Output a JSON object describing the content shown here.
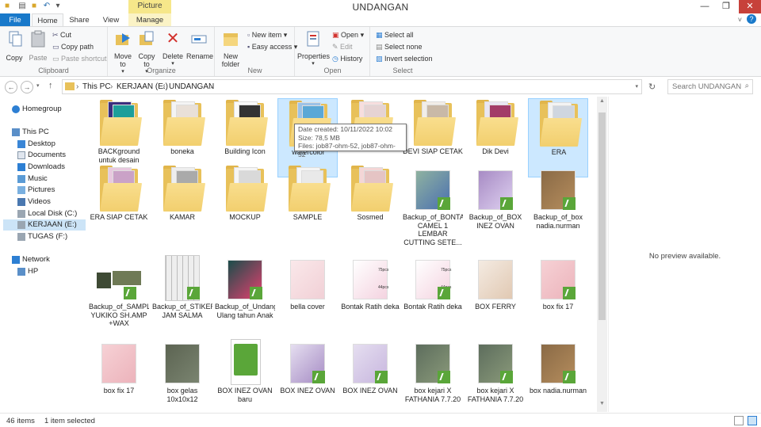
{
  "window": {
    "title": "UNDANGAN",
    "contextual_tab_group": "Picture Tools",
    "controls": {
      "minimize": "—",
      "restore": "❐",
      "close": "✕"
    }
  },
  "tabs": [
    {
      "label": "File"
    },
    {
      "label": "Home"
    },
    {
      "label": "Share"
    },
    {
      "label": "View"
    },
    {
      "label": "Manage"
    }
  ],
  "ribbon": {
    "clipboard": {
      "label": "Clipboard",
      "copy": "Copy",
      "paste": "Paste",
      "cut": "Cut",
      "copy_path": "Copy path",
      "paste_shortcut": "Paste shortcut"
    },
    "organize": {
      "label": "Organize",
      "move_to": "Move to",
      "copy_to": "Copy to",
      "delete": "Delete",
      "rename": "Rename"
    },
    "new": {
      "label": "New",
      "new_folder": "New folder",
      "new_item": "New item",
      "easy_access": "Easy access"
    },
    "open": {
      "label": "Open",
      "properties": "Properties",
      "open": "Open",
      "edit": "Edit",
      "history": "History"
    },
    "select": {
      "label": "Select",
      "select_all": "Select all",
      "select_none": "Select none",
      "invert": "Invert selection"
    }
  },
  "address": {
    "crumbs": [
      "This PC",
      "KERJAAN (E:)",
      "UNDANGAN"
    ],
    "separator": "›",
    "search_placeholder": "Search UNDANGAN"
  },
  "navpane": {
    "homegroup": "Homegroup",
    "this_pc": "This PC",
    "desktop": "Desktop",
    "documents": "Documents",
    "downloads": "Downloads",
    "music": "Music",
    "pictures": "Pictures",
    "videos": "Videos",
    "local_disk": "Local Disk (C:)",
    "kerjaan": "KERJAAN (E:)",
    "tugas": "TUGAS (F:)",
    "network": "Network",
    "hp": "HP"
  },
  "items": [
    {
      "name": "BACKground untuk desain",
      "kind": "folder"
    },
    {
      "name": "boneka",
      "kind": "folder"
    },
    {
      "name": "Building Icon",
      "kind": "folder"
    },
    {
      "name": "watercolor",
      "kind": "folder"
    },
    {
      "name": "",
      "kind": "folder"
    },
    {
      "name": "DEVI SIAP CETAK",
      "kind": "folder"
    },
    {
      "name": "Dik Devi",
      "kind": "folder"
    },
    {
      "name": "ERA",
      "kind": "folder"
    },
    {
      "name": "ERA SIAP CETAK",
      "kind": "folder"
    },
    {
      "name": "KAMAR",
      "kind": "folder"
    },
    {
      "name": "MOCKUP",
      "kind": "folder"
    },
    {
      "name": "SAMPLE",
      "kind": "folder"
    },
    {
      "name": "Sosmed",
      "kind": "folder"
    },
    {
      "name": "Backup_of_BONTAK CAMEL 1 LEMBAR CUTTING SETE...",
      "kind": "cdr"
    },
    {
      "name": "Backup_of_BOX INEZ OVAN",
      "kind": "cdr"
    },
    {
      "name": "Backup_of_box nadia.nurman",
      "kind": "cdr"
    },
    {
      "name": "Backup_of_SAMPLE YUKIKO SH.AMP +WAX",
      "kind": "cdr"
    },
    {
      "name": "Backup_of_STIKER JAM SALMA",
      "kind": "cdr"
    },
    {
      "name": "Backup_of_Undangan Ulang tahun Anak",
      "kind": "cdr"
    },
    {
      "name": "bella cover",
      "kind": "image"
    },
    {
      "name": "Bontak Ratih deka",
      "kind": "image"
    },
    {
      "name": "Bontak Ratih deka",
      "kind": "cdr"
    },
    {
      "name": "BOX FERRY",
      "kind": "image"
    },
    {
      "name": "box fix 17",
      "kind": "cdr"
    },
    {
      "name": "box fix 17",
      "kind": "image"
    },
    {
      "name": "box gelas 10x10x12",
      "kind": "image"
    },
    {
      "name": "BOX INEZ OVAN baru",
      "kind": "cdr-generic"
    },
    {
      "name": "BOX INEZ OVAN",
      "kind": "cdr"
    },
    {
      "name": "BOX INEZ OVAN",
      "kind": "cdr"
    },
    {
      "name": "box kejari X FATHANIA 7.7.20",
      "kind": "cdr"
    },
    {
      "name": "box kejari X FATHANIA 7.7.20",
      "kind": "cdr"
    },
    {
      "name": "box nadia.nurman",
      "kind": "cdr"
    }
  ],
  "thumb_text": {
    "pcs75": "75pcs",
    "pcs44": "44pcs"
  },
  "tooltip": {
    "line1": "Date created: 10/11/2022 10:02",
    "line2": "Size: 78,5 MB",
    "line3": "Files: job87-ohm-52, job87-ohm-52"
  },
  "preview": {
    "text": "No preview available."
  },
  "status": {
    "count": "46 items",
    "selected": "1 item selected"
  },
  "colors": {
    "accent": "#1979ca",
    "selection": "#cce8ff",
    "context_tab": "#f6e78a",
    "cdr_badge": "#5aa639"
  }
}
